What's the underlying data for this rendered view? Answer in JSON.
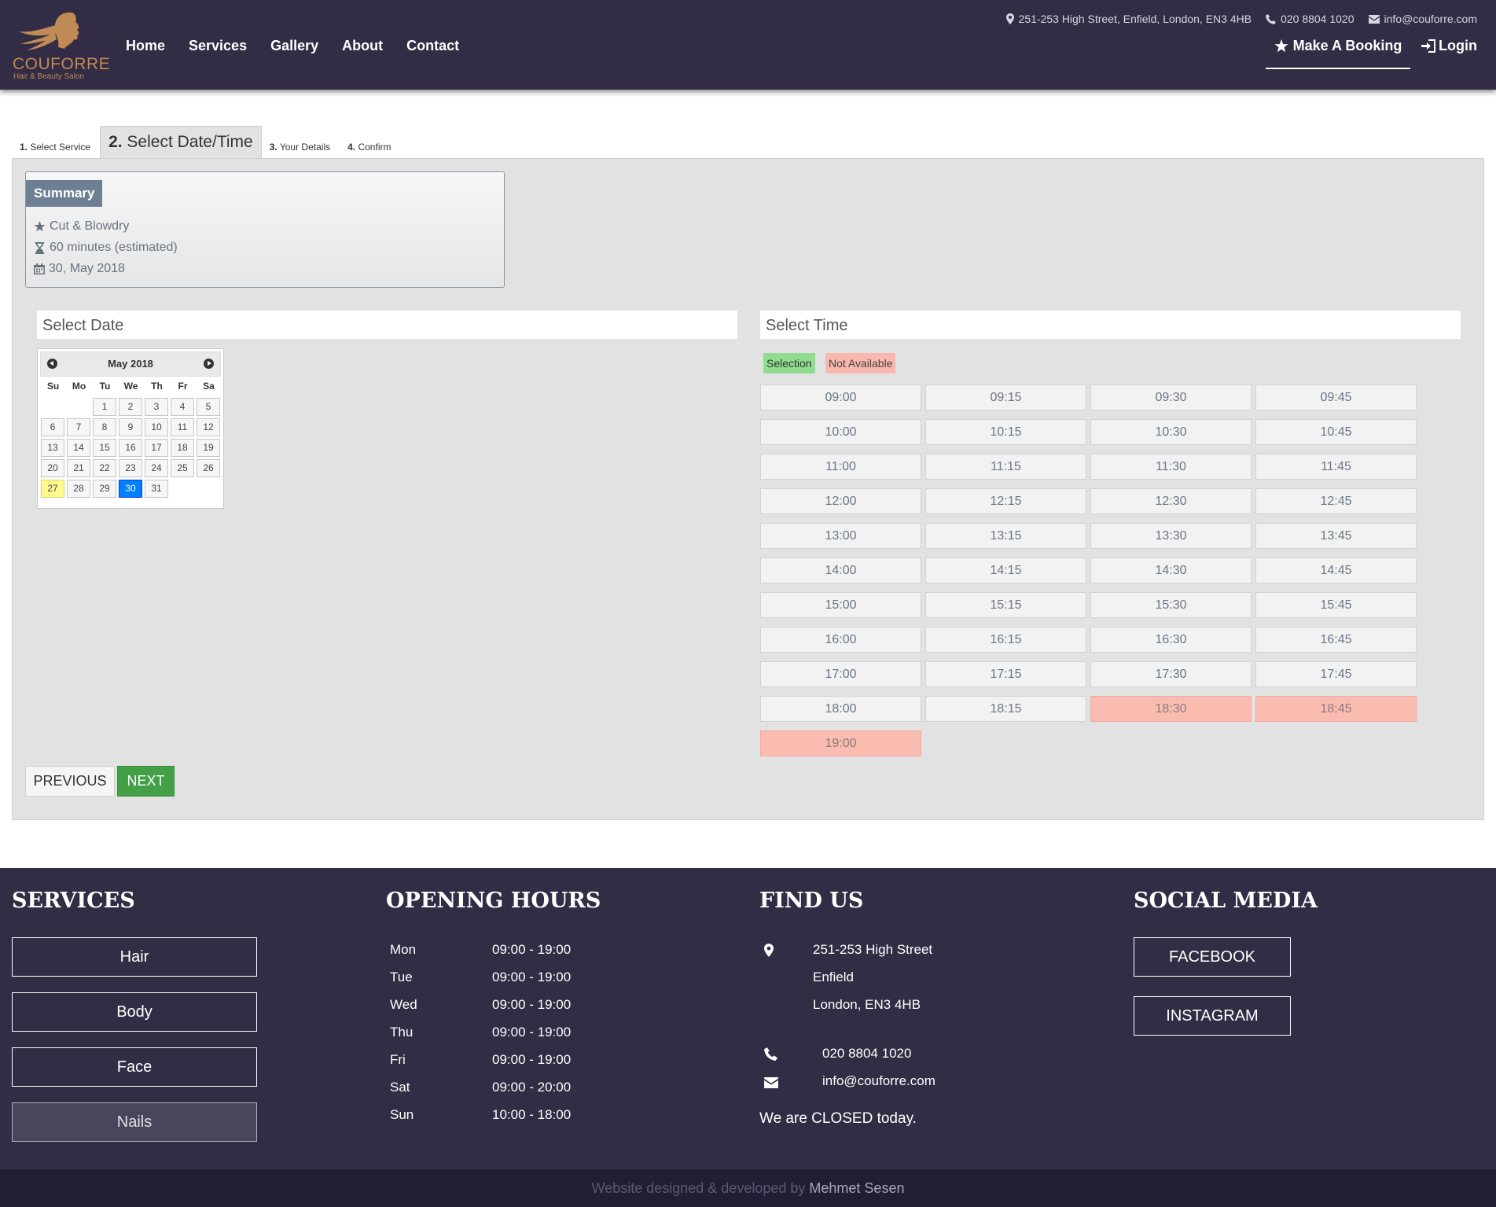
{
  "header": {
    "logo_name": "COUFORRE",
    "logo_tagline": "Hair & Beauty Salon",
    "nav": [
      "Home",
      "Services",
      "Gallery",
      "About",
      "Contact"
    ],
    "address": "251-253 High Street, Enfield, London, EN3 4HB",
    "phone": "020 8804 1020",
    "email": "info@couforre.com",
    "booking_label": "Make A Booking",
    "login_label": "Login"
  },
  "tabs": [
    {
      "num": "1.",
      "label": "Select Service"
    },
    {
      "num": "2.",
      "label": "Select Date/Time"
    },
    {
      "num": "3.",
      "label": "Your Details"
    },
    {
      "num": "4.",
      "label": "Confirm"
    }
  ],
  "summary": {
    "title": "Summary",
    "service": "Cut & Blowdry",
    "duration": "60 minutes (estimated)",
    "date": "30, May 2018"
  },
  "select_date": {
    "heading": "Select Date",
    "month_label": "May 2018",
    "weekdays": [
      "Su",
      "Mo",
      "Tu",
      "We",
      "Th",
      "Fr",
      "Sa"
    ],
    "first_weekday_index": 2,
    "days": [
      "1",
      "2",
      "3",
      "4",
      "5",
      "6",
      "7",
      "8",
      "9",
      "10",
      "11",
      "12",
      "13",
      "14",
      "15",
      "16",
      "17",
      "18",
      "19",
      "20",
      "21",
      "22",
      "23",
      "24",
      "25",
      "26",
      "27",
      "28",
      "29",
      "30",
      "31"
    ],
    "today": "27",
    "selected": "30"
  },
  "select_time": {
    "heading": "Select Time",
    "legend_selection": "Selection",
    "legend_not_available": "Not Available",
    "slots": [
      {
        "time": "09:00",
        "available": true
      },
      {
        "time": "09:15",
        "available": true
      },
      {
        "time": "09:30",
        "available": true
      },
      {
        "time": "09:45",
        "available": true
      },
      {
        "time": "10:00",
        "available": true
      },
      {
        "time": "10:15",
        "available": true
      },
      {
        "time": "10:30",
        "available": true
      },
      {
        "time": "10:45",
        "available": true
      },
      {
        "time": "11:00",
        "available": true
      },
      {
        "time": "11:15",
        "available": true
      },
      {
        "time": "11:30",
        "available": true
      },
      {
        "time": "11:45",
        "available": true
      },
      {
        "time": "12:00",
        "available": true
      },
      {
        "time": "12:15",
        "available": true
      },
      {
        "time": "12:30",
        "available": true
      },
      {
        "time": "12:45",
        "available": true
      },
      {
        "time": "13:00",
        "available": true
      },
      {
        "time": "13:15",
        "available": true
      },
      {
        "time": "13:30",
        "available": true
      },
      {
        "time": "13:45",
        "available": true
      },
      {
        "time": "14:00",
        "available": true
      },
      {
        "time": "14:15",
        "available": true
      },
      {
        "time": "14:30",
        "available": true
      },
      {
        "time": "14:45",
        "available": true
      },
      {
        "time": "15:00",
        "available": true
      },
      {
        "time": "15:15",
        "available": true
      },
      {
        "time": "15:30",
        "available": true
      },
      {
        "time": "15:45",
        "available": true
      },
      {
        "time": "16:00",
        "available": true
      },
      {
        "time": "16:15",
        "available": true
      },
      {
        "time": "16:30",
        "available": true
      },
      {
        "time": "16:45",
        "available": true
      },
      {
        "time": "17:00",
        "available": true
      },
      {
        "time": "17:15",
        "available": true
      },
      {
        "time": "17:30",
        "available": true
      },
      {
        "time": "17:45",
        "available": true
      },
      {
        "time": "18:00",
        "available": true
      },
      {
        "time": "18:15",
        "available": true
      },
      {
        "time": "18:30",
        "available": false
      },
      {
        "time": "18:45",
        "available": false
      },
      {
        "time": "19:00",
        "available": false
      }
    ]
  },
  "buttons": {
    "previous": "PREVIOUS",
    "next": "NEXT"
  },
  "footer": {
    "services_title": "SERVICES",
    "services": [
      "Hair",
      "Body",
      "Face",
      "Nails"
    ],
    "hours_title": "OPENING HOURS",
    "hours": [
      {
        "day": "Mon",
        "time": "09:00 - 19:00"
      },
      {
        "day": "Tue",
        "time": "09:00 - 19:00"
      },
      {
        "day": "Wed",
        "time": "09:00 - 19:00"
      },
      {
        "day": "Thu",
        "time": "09:00 - 19:00"
      },
      {
        "day": "Fri",
        "time": "09:00 - 19:00"
      },
      {
        "day": "Sat",
        "time": "09:00 - 20:00"
      },
      {
        "day": "Sun",
        "time": "10:00 - 18:00"
      }
    ],
    "find_title": "FIND US",
    "address_lines": [
      "251-253 High Street",
      "Enfield",
      "London, EN3 4HB"
    ],
    "phone": "020 8804 1020",
    "email": "info@couforre.com",
    "status": "We are CLOSED today.",
    "social_title": "SOCIAL MEDIA",
    "social": [
      "FACEBOOK",
      "INSTAGRAM"
    ]
  },
  "credit": {
    "text": "Website designed & developed by",
    "author": "Mehmet Sesen"
  },
  "colors": {
    "header_bg": "#322c45",
    "selection": "#90dd90",
    "not_available": "#f9b8ad",
    "next_button": "#43a047",
    "calendar_selected": "#007fff"
  }
}
